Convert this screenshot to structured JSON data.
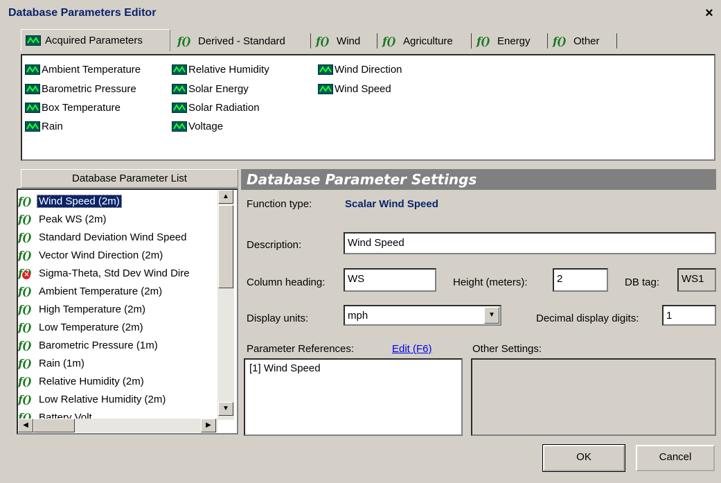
{
  "window": {
    "title": "Database Parameters Editor",
    "close_label": "×"
  },
  "tabs": [
    {
      "label": "Acquired Parameters",
      "icon": "acquired-icon",
      "selected": true
    },
    {
      "label": "Derived - Standard",
      "icon": "function-icon"
    },
    {
      "label": "Wind",
      "icon": "function-icon"
    },
    {
      "label": "Agriculture",
      "icon": "function-icon"
    },
    {
      "label": "Energy",
      "icon": "function-icon"
    },
    {
      "label": "Other",
      "icon": "function-icon"
    }
  ],
  "acquired": {
    "col1": [
      "Ambient Temperature",
      "Barometric Pressure",
      "Box Temperature",
      "Rain"
    ],
    "col2": [
      "Relative Humidity",
      "Solar Energy",
      "Solar Radiation",
      "Voltage"
    ],
    "col3": [
      "Wind Direction",
      "Wind Speed"
    ]
  },
  "param_list": {
    "header": "Database Parameter List",
    "items": [
      {
        "label": "Wind Speed (2m)",
        "selected": true
      },
      {
        "label": "Peak WS (2m)"
      },
      {
        "label": "Standard Deviation Wind Speed"
      },
      {
        "label": "Vector Wind Direction (2m)"
      },
      {
        "label": "Sigma-Theta, Std Dev Wind Dire",
        "error": true
      },
      {
        "label": "Ambient Temperature (2m)"
      },
      {
        "label": "High Temperature (2m)"
      },
      {
        "label": "Low Temperature (2m)"
      },
      {
        "label": "Barometric Pressure (1m)"
      },
      {
        "label": "Rain (1m)"
      },
      {
        "label": "Relative Humidity (2m)"
      },
      {
        "label": "Low Relative Humidity (2m)"
      },
      {
        "label": "Battery Volt..."
      }
    ]
  },
  "settings": {
    "header": "Database Parameter Settings",
    "function_type_label": "Function type:",
    "function_type_value": "Scalar Wind Speed",
    "description_label": "Description:",
    "description_value": "Wind Speed",
    "column_heading_label": "Column heading:",
    "column_heading_value": "WS",
    "height_label": "Height (meters):",
    "height_value": "2",
    "db_tag_label": "DB tag:",
    "db_tag_value": "WS1",
    "display_units_label": "Display units:",
    "display_units_value": "mph",
    "decimal_digits_label": "Decimal display digits:",
    "decimal_digits_value": "1",
    "param_refs_label": "Parameter References:",
    "edit_link": "Edit (F6)",
    "other_settings_label": "Other Settings:",
    "param_refs": [
      "[1] Wind Speed"
    ]
  },
  "buttons": {
    "ok": "OK",
    "cancel": "Cancel"
  }
}
